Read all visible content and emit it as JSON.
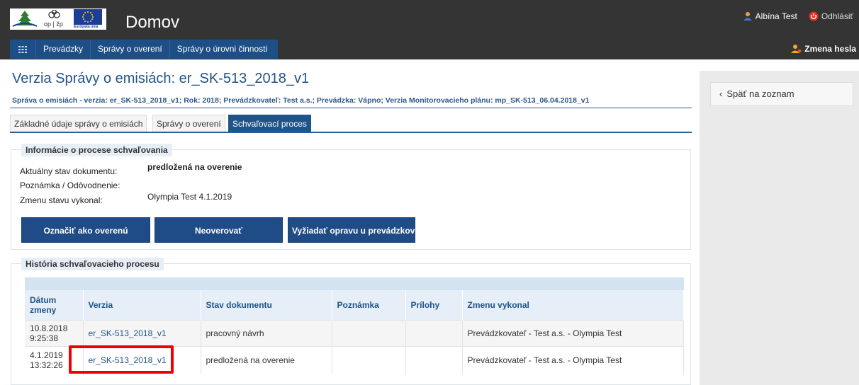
{
  "header": {
    "app_title": "Domov",
    "logo_op_text": "op | žp",
    "logo_eu_text": "Európska únia",
    "user_name": "Albína Test",
    "logout_label": "Odhlásiť",
    "change_password_label": "Zmena hesla"
  },
  "nav": {
    "items": [
      {
        "label": "Prevádzky"
      },
      {
        "label": "Správy o overení"
      },
      {
        "label": "Správy o úrovni činnosti"
      }
    ]
  },
  "page": {
    "title": "Verzia Správy o emisiách: er_SK-513_2018_v1",
    "subtitle": "Správa o emisiách - verzia: er_SK-513_2018_v1; Rok: 2018; Prevádzkovateľ: Test a.s.; Prevádzka: Vápno; Verzia Monitorovacieho plánu: mp_SK-513_06.04.2018_v1"
  },
  "tabs": [
    {
      "label": "Základné údaje správy o emisiách",
      "active": false
    },
    {
      "label": "Správy o overení",
      "active": false
    },
    {
      "label": "Schvaľovací proces",
      "active": true
    }
  ],
  "info": {
    "legend": "Informácie o procese schvaľovania",
    "state_label": "Aktuálny stav dokumentu:",
    "state_value": "predložená na overenie",
    "note_label": "Poznámka / Odôvodnenie:",
    "changed_by_label": "Zmenu stavu vykonal:",
    "changed_by_value": "Olympia Test 4.1.2019",
    "buttons": {
      "mark_verified": "Označiť ako overenú",
      "not_verify": "Neoverovať",
      "request_fix": "Vyžiadať opravu u prevádzkovateľa"
    }
  },
  "history": {
    "legend": "História schvaľovacieho procesu",
    "columns": [
      "Dátum zmeny",
      "Verzia",
      "Stav dokumentu",
      "Poznámka",
      "Prílohy",
      "Zmenu vykonal"
    ],
    "rows": [
      {
        "date": "10.8.2018",
        "time": "9:25:38",
        "version": "er_SK-513_2018_v1",
        "status": "pracovný návrh",
        "note": "",
        "attachments": "",
        "changed_by": "Prevádzkovateľ - Test a.s. - Olympia Test"
      },
      {
        "date": "4.1.2019",
        "time": "13:32:26",
        "version": "er_SK-513_2018_v1",
        "status": "predložená na overenie",
        "note": "",
        "attachments": "",
        "changed_by": "Prevádzkovateľ - Test a.s. - Olympia Test"
      }
    ]
  },
  "sidebar": {
    "back_label": "Späť na zoznam"
  },
  "colors": {
    "header_bg": "#343434",
    "nav_bg": "#1d4f86",
    "accent": "#1f5489",
    "highlight": "#ee0000"
  }
}
